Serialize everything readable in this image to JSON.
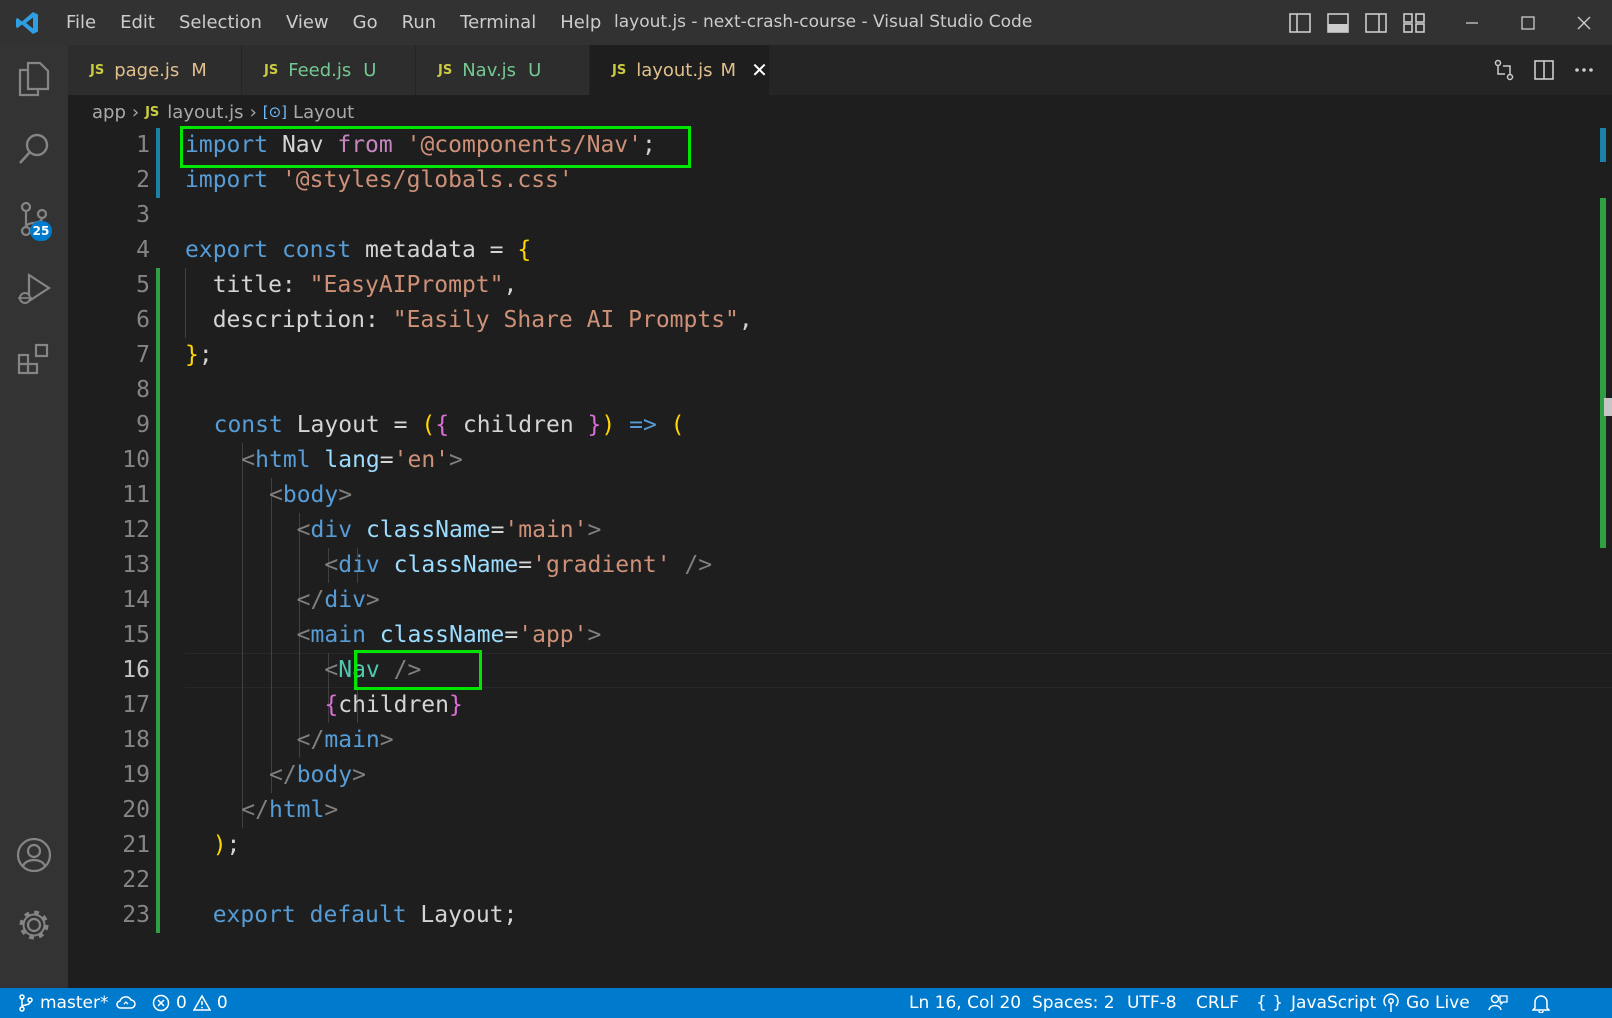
{
  "window": {
    "title": "layout.js - next-crash-course - Visual Studio Code",
    "menu": [
      "File",
      "Edit",
      "Selection",
      "View",
      "Go",
      "Run",
      "Terminal",
      "Help"
    ]
  },
  "activity": {
    "source_control_badge": "25"
  },
  "tabs": [
    {
      "lang": "JS",
      "name": "page.js",
      "status": "M",
      "active": false
    },
    {
      "lang": "JS",
      "name": "Feed.js",
      "status": "U",
      "active": false
    },
    {
      "lang": "JS",
      "name": "Nav.js",
      "status": "U",
      "active": false
    },
    {
      "lang": "JS",
      "name": "layout.js",
      "status": "M",
      "active": true
    }
  ],
  "breadcrumb": {
    "folder": "app",
    "file_lang": "JS",
    "file": "layout.js",
    "symbol": "Layout"
  },
  "editor": {
    "current_line": 16,
    "lines": [
      [
        [
          "kw",
          "import"
        ],
        [
          "tx",
          " Nav "
        ],
        [
          "kw2",
          "from"
        ],
        [
          "tx",
          " "
        ],
        [
          "str",
          "'@components/Nav'"
        ],
        [
          "tx",
          ";"
        ]
      ],
      [
        [
          "kw",
          "import"
        ],
        [
          "tx",
          " "
        ],
        [
          "str",
          "'@styles/globals.css'"
        ]
      ],
      [],
      [
        [
          "kw",
          "export"
        ],
        [
          "tx",
          " "
        ],
        [
          "kw",
          "const"
        ],
        [
          "tx",
          " metadata = "
        ],
        [
          "b1",
          "{"
        ]
      ],
      [
        [
          "tx",
          "  title: "
        ],
        [
          "str",
          "\"EasyAIPrompt\""
        ],
        [
          "tx",
          ","
        ]
      ],
      [
        [
          "tx",
          "  description: "
        ],
        [
          "str",
          "\"Easily Share AI Prompts\""
        ],
        [
          "tx",
          ","
        ]
      ],
      [
        [
          "b1",
          "}"
        ],
        [
          "tx",
          ";"
        ]
      ],
      [],
      [
        [
          "kw",
          "const"
        ],
        [
          "tx",
          " Layout = "
        ],
        [
          "b1",
          "("
        ],
        [
          "b2",
          "{"
        ],
        [
          "tx",
          " children "
        ],
        [
          "b2",
          "}"
        ],
        [
          "b1",
          ")"
        ],
        [
          "tx",
          " "
        ],
        [
          "kw",
          "=>"
        ],
        [
          "tx",
          " "
        ],
        [
          "b1",
          "("
        ]
      ],
      [
        [
          "pun",
          "  <"
        ],
        [
          "tag",
          "html"
        ],
        [
          "tx",
          " "
        ],
        [
          "attr",
          "lang"
        ],
        [
          "tx",
          "="
        ],
        [
          "str",
          "'en'"
        ],
        [
          "pun",
          ">"
        ]
      ],
      [
        [
          "pun",
          "    <"
        ],
        [
          "tag",
          "body"
        ],
        [
          "pun",
          ">"
        ]
      ],
      [
        [
          "pun",
          "      <"
        ],
        [
          "tag",
          "div"
        ],
        [
          "tx",
          " "
        ],
        [
          "attr",
          "className"
        ],
        [
          "tx",
          "="
        ],
        [
          "str",
          "'main'"
        ],
        [
          "pun",
          ">"
        ]
      ],
      [
        [
          "pun",
          "        <"
        ],
        [
          "tag",
          "div"
        ],
        [
          "tx",
          " "
        ],
        [
          "attr",
          "className"
        ],
        [
          "tx",
          "="
        ],
        [
          "str",
          "'gradient'"
        ],
        [
          "tx",
          " "
        ],
        [
          "pun",
          "/>"
        ]
      ],
      [
        [
          "pun",
          "      </"
        ],
        [
          "tag",
          "div"
        ],
        [
          "pun",
          ">"
        ]
      ],
      [
        [
          "pun",
          "      <"
        ],
        [
          "tag",
          "main"
        ],
        [
          "tx",
          " "
        ],
        [
          "attr",
          "className"
        ],
        [
          "tx",
          "="
        ],
        [
          "str",
          "'app'"
        ],
        [
          "pun",
          ">"
        ]
      ],
      [
        [
          "pun",
          "        <"
        ],
        [
          "cmp",
          "Nav"
        ],
        [
          "tx",
          " "
        ],
        [
          "pun",
          "/>"
        ]
      ],
      [
        [
          "b2",
          "        {"
        ],
        [
          "tx",
          "children"
        ],
        [
          "b2",
          "}"
        ]
      ],
      [
        [
          "pun",
          "      </"
        ],
        [
          "tag",
          "main"
        ],
        [
          "pun",
          ">"
        ]
      ],
      [
        [
          "pun",
          "    </"
        ],
        [
          "tag",
          "body"
        ],
        [
          "pun",
          ">"
        ]
      ],
      [
        [
          "pun",
          "  </"
        ],
        [
          "tag",
          "html"
        ],
        [
          "pun",
          ">"
        ]
      ],
      [
        [
          "b1",
          "  )"
        ],
        [
          "tx",
          ";"
        ]
      ],
      [],
      [
        [
          "kw",
          "  export"
        ],
        [
          "tx",
          " "
        ],
        [
          "kw",
          "default"
        ],
        [
          "tx",
          " Layout;"
        ]
      ]
    ]
  },
  "status": {
    "branch": "master*",
    "errors": "0",
    "warnings": "0",
    "position": "Ln 16, Col 20",
    "spaces": "Spaces: 2",
    "encoding": "UTF-8",
    "eol": "CRLF",
    "language": "JavaScript",
    "language_icon": "{ }",
    "golive": "Go Live"
  },
  "colors": {
    "accent": "#007acc",
    "highlight_box": "#00e600",
    "git_added": "#2ea043"
  }
}
